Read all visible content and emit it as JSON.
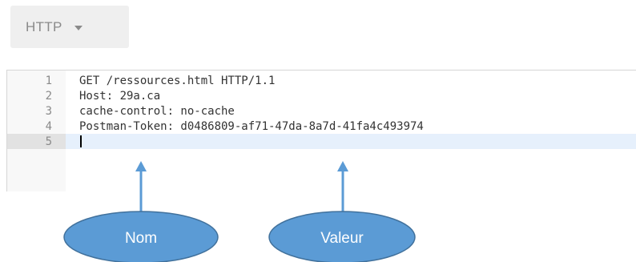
{
  "dropdown": {
    "label": "HTTP",
    "caret_icon": "chevron-down-icon"
  },
  "editor": {
    "lines": [
      {
        "num": "1",
        "text": "GET /ressources.html HTTP/1.1"
      },
      {
        "num": "2",
        "text": "Host: 29a.ca"
      },
      {
        "num": "3",
        "text": "cache-control: no-cache"
      },
      {
        "num": "4",
        "text": "Postman-Token: d0486809-af71-47da-8a7d-41fa4c493974"
      },
      {
        "num": "5",
        "text": ""
      }
    ],
    "active_line": "5"
  },
  "annotations": {
    "name_label": "Nom",
    "value_label": "Valeur",
    "bubble_color": "#5b9bd5",
    "bubble_border": "#41719c"
  }
}
